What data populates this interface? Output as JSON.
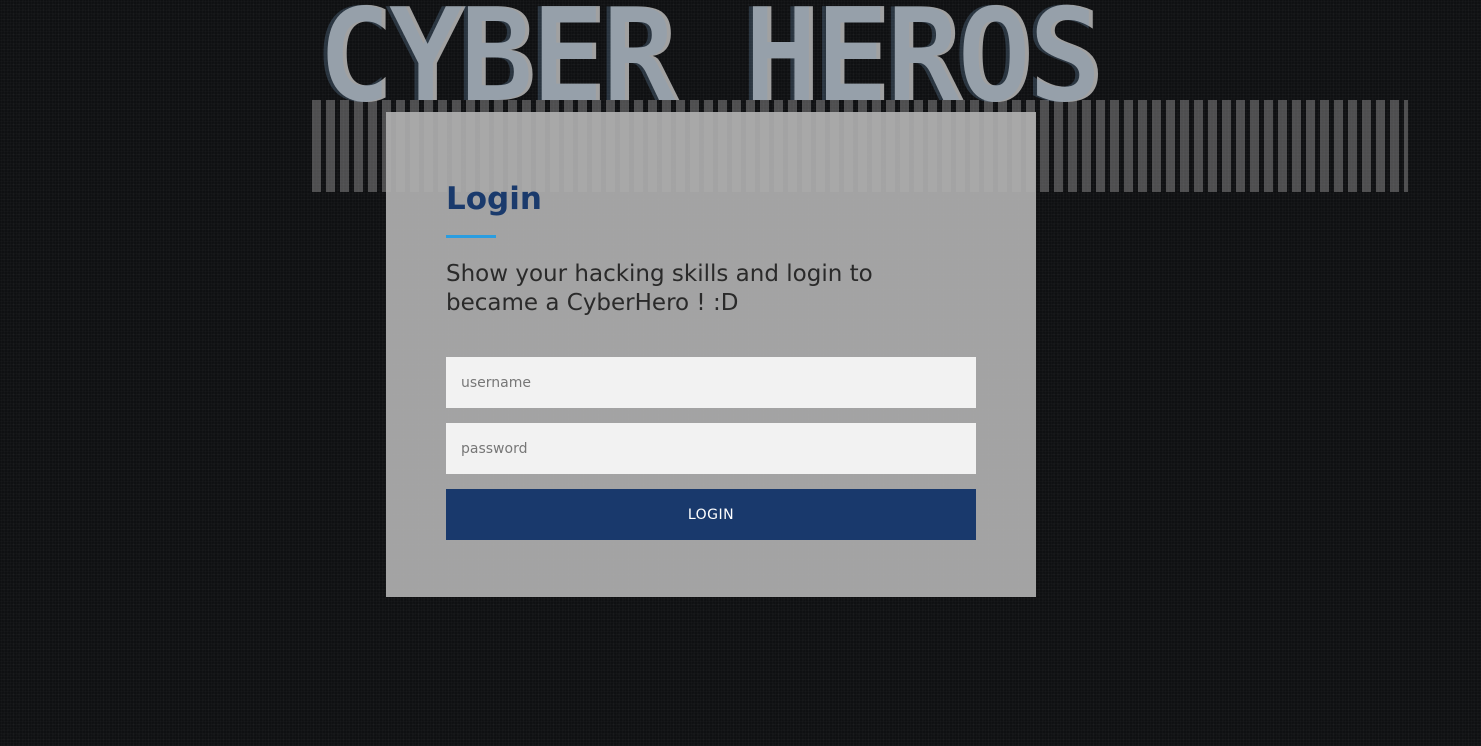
{
  "banner": {
    "logo_text": "CYBER HEROS"
  },
  "login": {
    "title": "Login",
    "description": "Show your hacking skills and login to became a CyberHero ! :D",
    "username_placeholder": "username",
    "password_placeholder": "password",
    "button_label": "LOGIN"
  },
  "colors": {
    "title": "#1a3a6c",
    "underline_accent": "#2a9de0",
    "button": "#19396c",
    "card": "#b0b0b0",
    "background": "#0f1012"
  }
}
